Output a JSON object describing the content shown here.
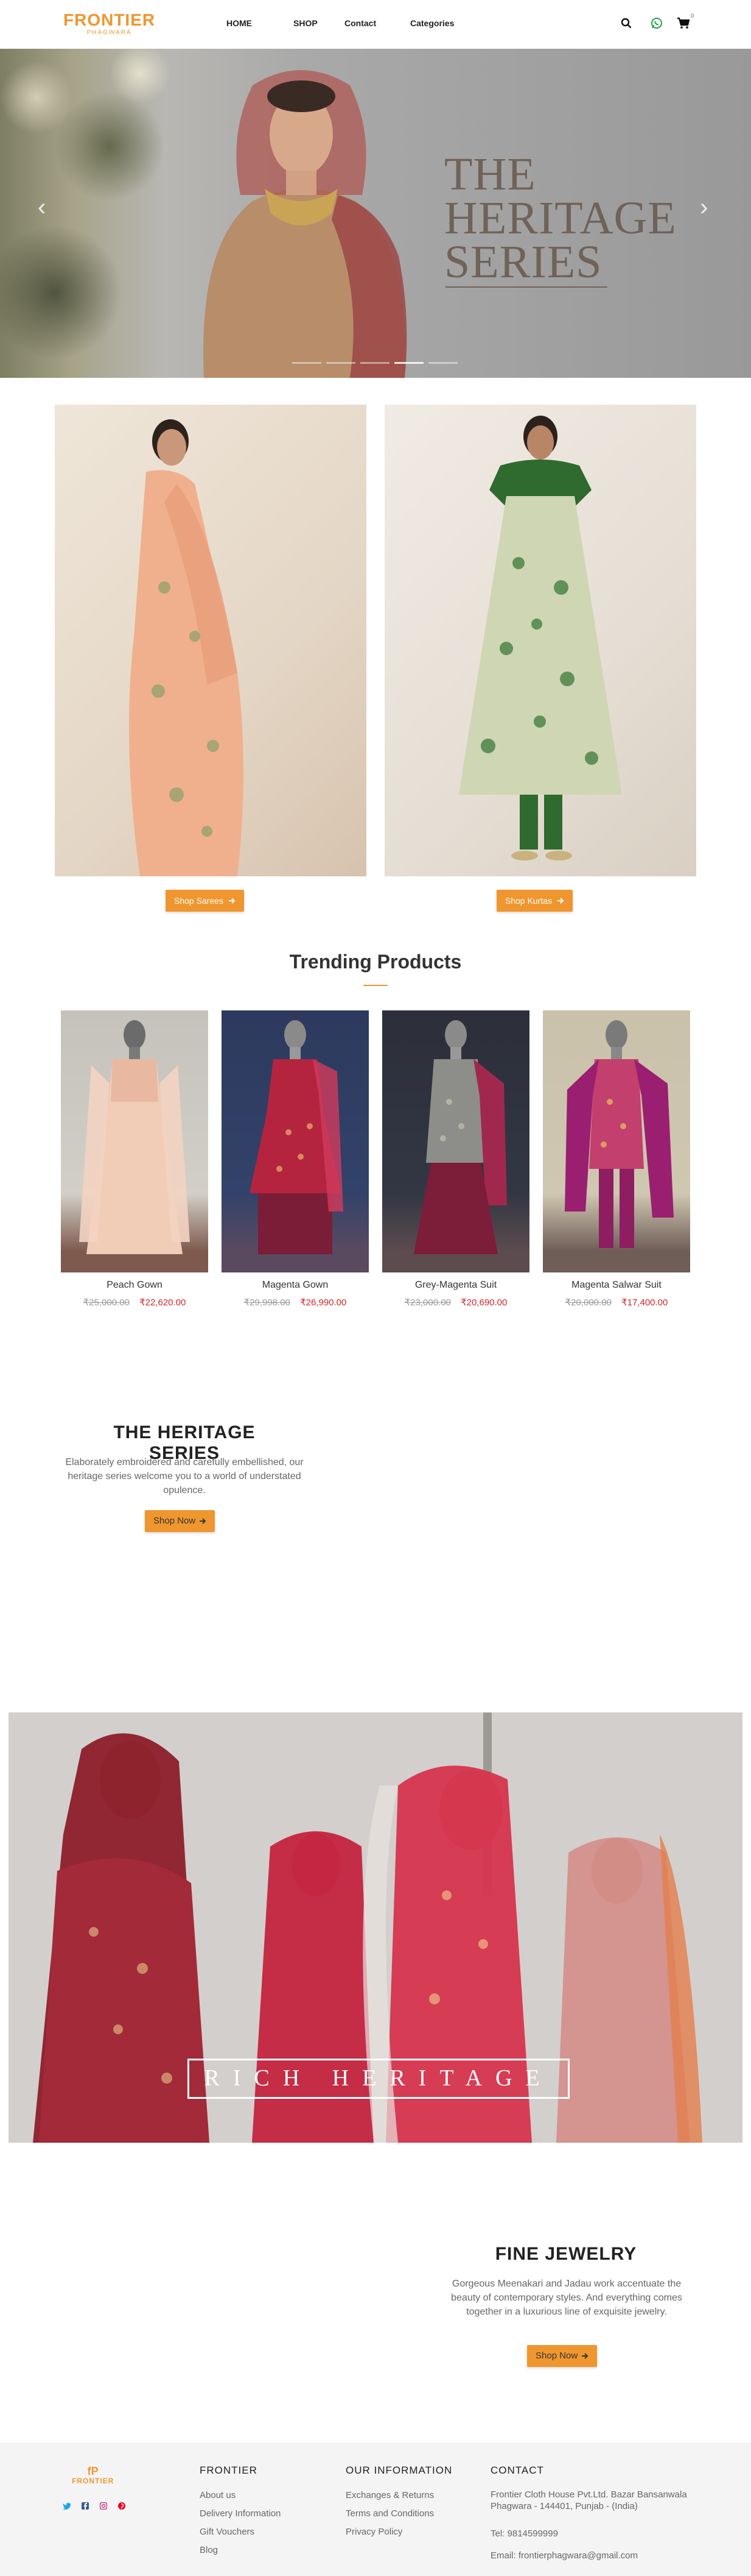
{
  "header": {
    "logo_main": "FRONTIER",
    "logo_sub": "PHAGWARA",
    "nav": [
      "HOME",
      "SHOP",
      "Contact",
      "Categories"
    ],
    "cart_count": "0"
  },
  "hero": {
    "title_line1": "THE",
    "title_line2": "HERITAGE",
    "title_line3": "SERIES",
    "prev_arrow": "‹",
    "next_arrow": "›",
    "slide_count": 5,
    "active_slide": 4
  },
  "categories": [
    {
      "button": "Shop Sarees"
    },
    {
      "button": "Shop Kurtas"
    }
  ],
  "trending": {
    "title": "Trending Products",
    "products": [
      {
        "name": "Peach Gown",
        "old_price": "₹25,000.00",
        "price": "₹22,620.00"
      },
      {
        "name": "Magenta Gown",
        "old_price": "₹29,998.00",
        "price": "₹26,990.00"
      },
      {
        "name": "Grey-Magenta Suit",
        "old_price": "₹23,000.00",
        "price": "₹20,690.00"
      },
      {
        "name": "Magenta Salwar Suit",
        "old_price": "₹20,000.00",
        "price": "₹17,400.00"
      }
    ]
  },
  "heritage": {
    "title": "THE HERITAGE SERIES",
    "description": "Elaborately embroidered and carefully embellished, our heritage series welcome you to a world of understated opulence.",
    "button": "Shop Now"
  },
  "banner": {
    "text": "RICH HERITAGE"
  },
  "jewelry": {
    "title": "FINE JEWELRY",
    "description": "Gorgeous Meenakari and Jadau work accentuate the beauty of contemporary styles. And everything comes together in a luxurious line of exquisite jewelry.",
    "button": "Shop Now"
  },
  "footer": {
    "logo_mark": "fP",
    "logo_name": "FRONTIER",
    "col1_title": "FRONTIER",
    "col1_links": [
      "About us",
      "Delivery Information",
      "Gift Vouchers",
      "Blog"
    ],
    "col2_title": "OUR INFORMATION",
    "col2_links": [
      "Exchanges & Returns",
      "Terms and Conditions",
      "Privacy Policy"
    ],
    "col3_title": "CONTACT",
    "address": "Frontier Cloth House Pvt.Ltd. Bazar Bansanwala Phagwara - 144401, Punjab - (India)",
    "tel": "Tel: 9814599999",
    "email": "Email: frontierphagwara@gmail.com"
  },
  "colors": {
    "accent": "#f0962f",
    "sale_price": "#d3242c",
    "footer_bg": "#f4f4f4"
  }
}
